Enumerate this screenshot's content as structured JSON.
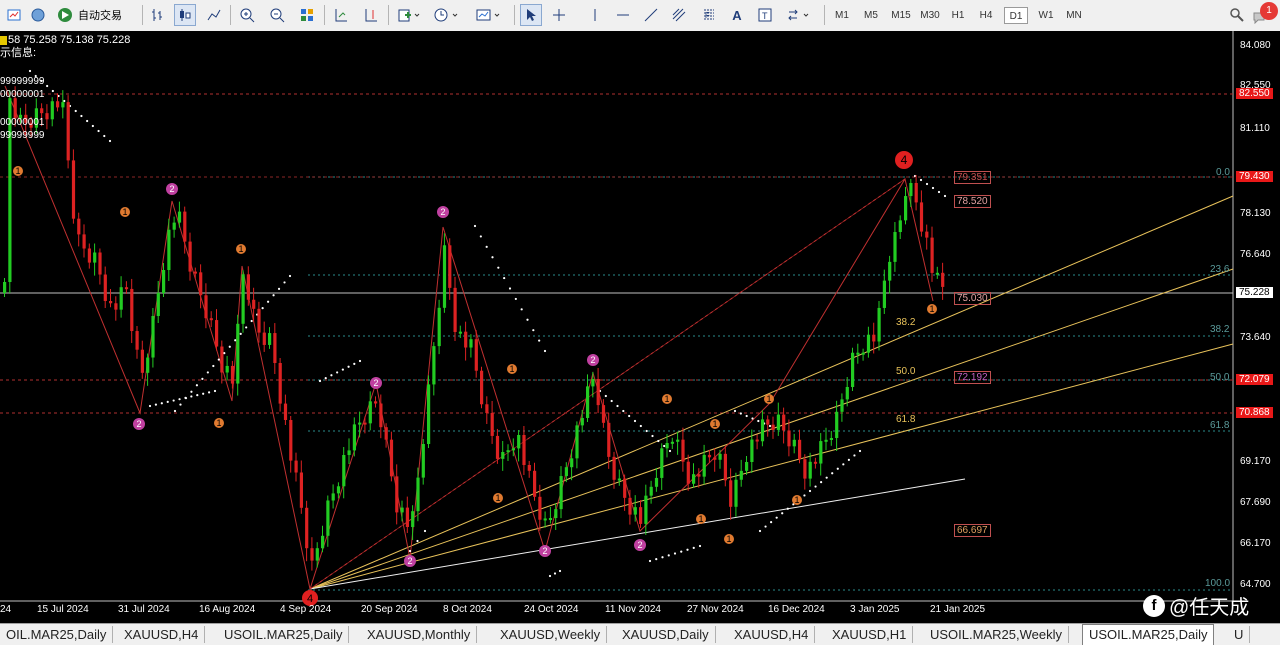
{
  "toolbar": {
    "autotrade_label": "自动交易",
    "timeframes": [
      "M1",
      "M5",
      "M15",
      "M30",
      "H1",
      "H4",
      "D1",
      "W1",
      "MN"
    ],
    "active_timeframe": "D1",
    "notification_count": "1"
  },
  "chart": {
    "info_line": "58 75.258 75.138 75.228",
    "info_sub": "示信息:",
    "info_values": [
      "99999999",
      "00000001",
      "00000001",
      "99999999"
    ],
    "price_labels": [
      "84.080",
      "82.550",
      "81.110",
      "79.430",
      "78.130",
      "76.640",
      "75.228",
      "73.640",
      "72.079",
      "70.868",
      "69.170",
      "67.690",
      "66.170",
      "64.700"
    ],
    "price_highlights": {
      "p82": "82.550",
      "p79": "79.430",
      "p75": "75.228",
      "p72": "72.079",
      "p70": "70.868"
    },
    "date_labels": [
      "24",
      "15 Jul 2024",
      "31 Jul 2024",
      "16 Aug 2024",
      "4 Sep 2024",
      "20 Sep 2024",
      "8 Oct 2024",
      "24 Oct 2024",
      "11 Nov 2024",
      "27 Nov 2024",
      "16 Dec 2024",
      "3 Jan 2025",
      "21 Jan 2025"
    ],
    "fib_labels_right": [
      "0.0",
      "23.6",
      "38.2",
      "50.0",
      "61.8",
      "100.0"
    ],
    "fib_labels_mid": [
      "38.2",
      "50.0",
      "61.8"
    ],
    "box_labels": [
      "79.351",
      "78.520",
      "75.030",
      "72.192",
      "66.697"
    ],
    "wave_labels": [
      "4",
      "2",
      "1"
    ],
    "watermark": "@任天成"
  },
  "tabs": [
    "OIL.MAR25,Daily",
    "XAUUSD,H4",
    "USOIL.MAR25,Daily",
    "XAUUSD,Monthly",
    "XAUUSD,Weekly",
    "XAUUSD,Daily",
    "XAUUSD,H4",
    "XAUUSD,H1",
    "USOIL.MAR25,Weekly",
    "USOIL.MAR25,Daily",
    "U"
  ],
  "active_tab": "USOIL.MAR25,Daily"
}
